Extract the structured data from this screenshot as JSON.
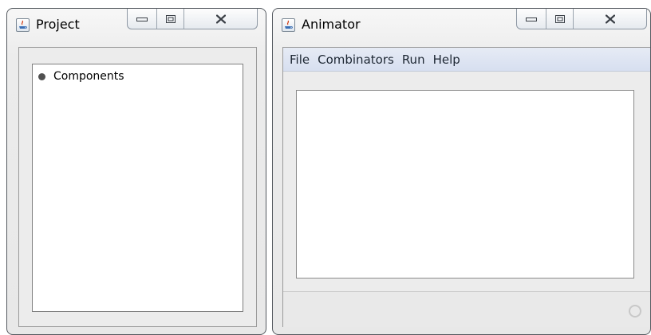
{
  "project_window": {
    "title": "Project",
    "icon": "java-app-icon",
    "controls": [
      "minimize-icon",
      "maximize-icon",
      "close-icon"
    ],
    "tree": {
      "items": [
        {
          "label": "Components",
          "icon": "tree-node-bullet-icon"
        }
      ]
    }
  },
  "animator_window": {
    "title": "Animator",
    "icon": "java-app-icon",
    "controls": [
      "minimize-icon",
      "maximize-icon",
      "close-icon"
    ],
    "menu": {
      "items": [
        "File",
        "Combinators",
        "Run",
        "Help"
      ]
    },
    "status": {
      "indicator": "busy-spinner-icon"
    }
  },
  "colors": {
    "frame": "#555a60",
    "menubar": "#dde3f2",
    "panel_bg": "#ececec",
    "content_bg": "#ffffff"
  }
}
